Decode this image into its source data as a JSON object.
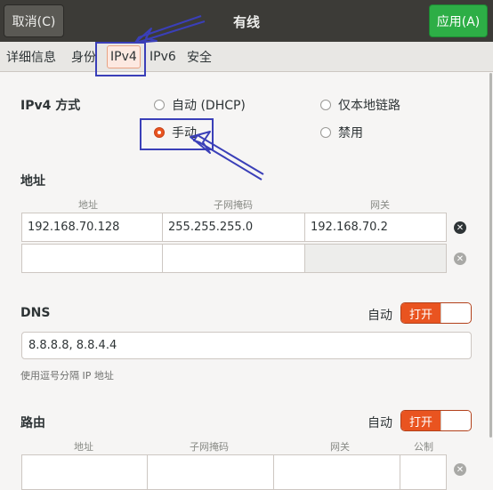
{
  "header": {
    "cancel_label": "取消(C)",
    "title": "有线",
    "apply_label": "应用(A)",
    "apply_color": "#2dae46"
  },
  "tabs": [
    {
      "label": "详细信息"
    },
    {
      "label": "身份"
    },
    {
      "label": "IPv4"
    },
    {
      "label": "IPv6"
    },
    {
      "label": "安全"
    }
  ],
  "ipv4_method": {
    "label": "IPv4 方式",
    "options": [
      {
        "label": "自动 (DHCP)",
        "selected": false
      },
      {
        "label": "仅本地链路",
        "selected": false
      },
      {
        "label": "手动",
        "selected": true
      },
      {
        "label": "禁用",
        "selected": false
      }
    ]
  },
  "addresses": {
    "label": "地址",
    "columns": [
      "地址",
      "子网掩码",
      "网关"
    ],
    "rows": [
      [
        "192.168.70.128",
        "255.255.255.0",
        "192.168.70.2"
      ],
      [
        "",
        "",
        ""
      ]
    ]
  },
  "dns": {
    "label": "DNS",
    "auto_label": "自动",
    "switch_label": "打开",
    "value": "8.8.8.8, 8.8.4.4",
    "hint": "使用逗号分隔 IP 地址"
  },
  "routes": {
    "label": "路由",
    "auto_label": "自动",
    "switch_label": "打开",
    "columns": [
      "地址",
      "子网掩码",
      "网关",
      "公制"
    ]
  },
  "colors": {
    "accent": "#e95420",
    "headerbar": "#3c3b37",
    "annotation": "#3a3fb8"
  },
  "icons": {
    "delete": "remove-circle-icon"
  }
}
